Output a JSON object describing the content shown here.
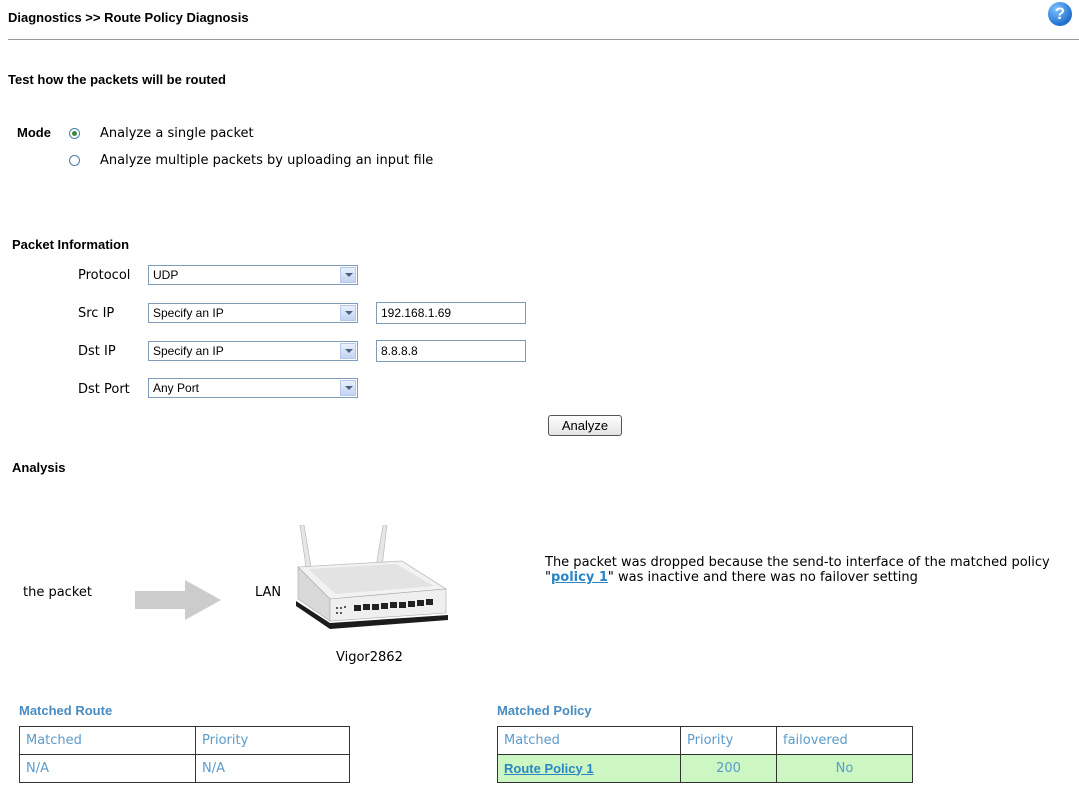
{
  "header": {
    "title": "Diagnostics >> Route Policy Diagnosis",
    "help_icon": "question-mark-icon"
  },
  "test_section": {
    "title": "Test how the packets will be routed"
  },
  "mode": {
    "label": "Mode",
    "options": [
      {
        "label": "Analyze a single packet",
        "selected": true
      },
      {
        "label": "Analyze multiple packets by uploading an input file",
        "selected": false
      }
    ]
  },
  "packet_info": {
    "title": "Packet Information",
    "protocol": {
      "label": "Protocol",
      "value": "UDP"
    },
    "src_ip": {
      "label": "Src IP",
      "select": "Specify an IP",
      "value": "192.168.1.69"
    },
    "dst_ip": {
      "label": "Dst IP",
      "select": "Specify an IP",
      "value": "8.8.8.8"
    },
    "dst_port": {
      "label": "Dst Port",
      "value": "Any Port"
    },
    "analyze_label": "Analyze"
  },
  "analysis": {
    "title": "Analysis",
    "packet_label": "the packet",
    "lan_label": "LAN",
    "router_name": "Vigor2862",
    "message_before": "The packet was dropped because the send-to interface of the matched policy \"",
    "message_link": "policy 1",
    "message_after": "\" was inactive and there was no failover setting"
  },
  "matched_route": {
    "title": "Matched Route",
    "columns": [
      "Matched",
      "Priority"
    ],
    "rows": [
      [
        "N/A",
        "N/A"
      ]
    ]
  },
  "matched_policy": {
    "title": "Matched Policy",
    "columns": [
      "Matched",
      "Priority",
      "failovered"
    ],
    "rows": [
      [
        "Route Policy 1",
        "200",
        "No"
      ]
    ],
    "highlight_color": "#ccf7c2"
  }
}
